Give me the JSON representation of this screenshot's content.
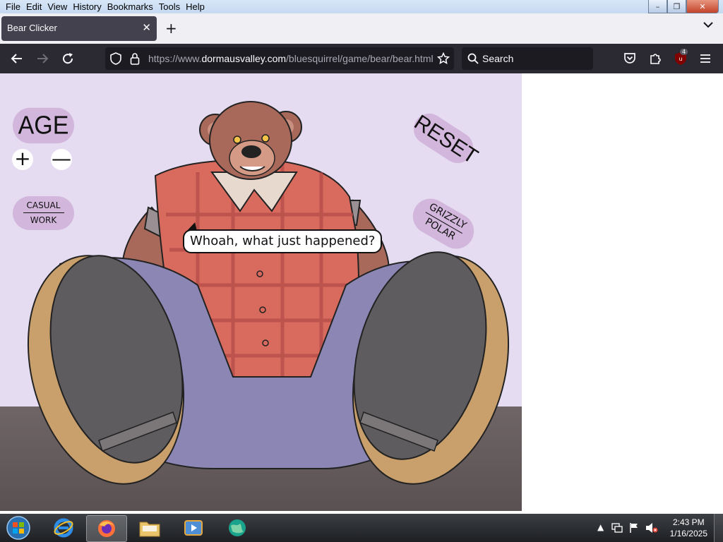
{
  "menu": {
    "items": [
      "File",
      "Edit",
      "View",
      "History",
      "Bookmarks",
      "Tools",
      "Help"
    ]
  },
  "window_controls": {
    "minimize": "–",
    "maximize": "❐",
    "close": "✕"
  },
  "tab": {
    "title": "Bear Clicker",
    "close": "✕",
    "new_tab": "+"
  },
  "nav": {
    "url_prefix": "https://www.",
    "url_host": "dormausvalley.com",
    "url_path": "/bluesquirrel/game/bear/bear.html",
    "search_placeholder": "Search",
    "extension_badge": "4"
  },
  "game": {
    "age_label": "AGE",
    "plus": "+",
    "minus": "—",
    "mode_top": "CASUAL",
    "mode_bottom": "WORK",
    "reset_label": "RESET",
    "species_top": "GRIZZLY",
    "species_bottom": "POLAR",
    "speech": "Whoah, what just happened?"
  },
  "taskbar": {
    "time": "2:43 PM",
    "date": "1/16/2025"
  },
  "colors": {
    "page_bg": "#e6dcf2",
    "button_bg": "#d2b6dc",
    "shirt": "#d86a5e",
    "jeans": "#8b86b4",
    "fur": "#a9695a"
  }
}
